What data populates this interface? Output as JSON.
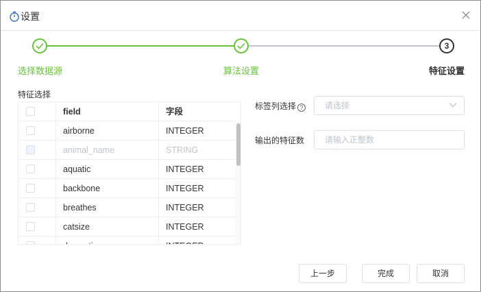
{
  "dialog": {
    "title": "设置"
  },
  "steps": [
    {
      "label": "选择数据源",
      "status": "done"
    },
    {
      "label": "算法设置",
      "status": "done"
    },
    {
      "label": "特征设置",
      "status": "current",
      "number": "3"
    }
  ],
  "colors": {
    "success": "#67c23a",
    "current": "#303133",
    "border": "#dcdfe6",
    "placeholder": "#c0c4cc"
  },
  "feature_section": {
    "title": "特征选择",
    "columns": [
      "field",
      "字段"
    ],
    "rows": [
      {
        "field": "airborne",
        "type": "INTEGER",
        "disabled": false
      },
      {
        "field": "animal_name",
        "type": "STRING",
        "disabled": true
      },
      {
        "field": "aquatic",
        "type": "INTEGER",
        "disabled": false
      },
      {
        "field": "backbone",
        "type": "INTEGER",
        "disabled": false
      },
      {
        "field": "breathes",
        "type": "INTEGER",
        "disabled": false
      },
      {
        "field": "catsize",
        "type": "INTEGER",
        "disabled": false
      },
      {
        "field": "domestic",
        "type": "INTEGER",
        "disabled": false
      }
    ]
  },
  "form": {
    "label_column": {
      "label": "标签列选择",
      "help_icon": "question-circle-icon",
      "placeholder": "请选择"
    },
    "feature_count": {
      "label": "输出的特征数",
      "placeholder": "请输入正整数"
    }
  },
  "footer": {
    "prev": "上一步",
    "finish": "完成",
    "cancel": "取消"
  }
}
